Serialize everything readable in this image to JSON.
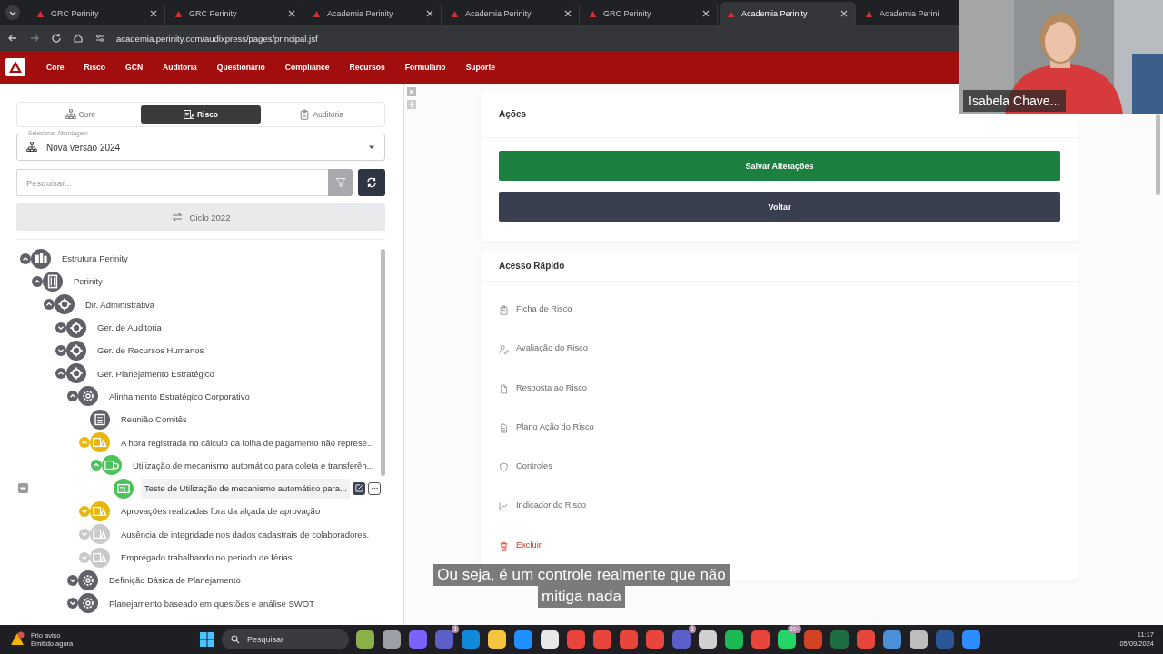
{
  "browser": {
    "tabs": [
      {
        "title": "GRC Perinity",
        "selected": false
      },
      {
        "title": "GRC Perinity",
        "selected": false
      },
      {
        "title": "Academia Perinity",
        "selected": false
      },
      {
        "title": "Academia Perinity",
        "selected": false
      },
      {
        "title": "GRC Perinity",
        "selected": false
      },
      {
        "title": "Academia Perinity",
        "selected": true
      },
      {
        "title": "Academia Perini",
        "selected": false
      }
    ],
    "url": "academia.perinity.com/audixpress/pages/principal.jsf"
  },
  "nav": {
    "items": [
      "Core",
      "Risco",
      "GCN",
      "Auditoria",
      "Questionário",
      "Compliance",
      "Recursos",
      "Formulário",
      "Suporte"
    ]
  },
  "left_panel": {
    "tabs": [
      {
        "label": "Core",
        "kind": "core",
        "selected": false
      },
      {
        "label": "Risco",
        "kind": "risk",
        "selected": true
      },
      {
        "label": "Auditoria",
        "kind": "audit",
        "selected": false
      }
    ],
    "approach": {
      "label": "Selecionar Abordagem",
      "value": "Nova versão 2024"
    },
    "search": {
      "placeholder": "Pesquisar..."
    },
    "cycle_button": "Ciclo 2022",
    "tree": [
      {
        "label": "Estrutura Perinity",
        "kind": "org",
        "color": "#5f6068",
        "expanded": true,
        "selected": false,
        "children": [
          {
            "label": "Perinity",
            "kind": "building",
            "color": "#5f6068",
            "expanded": true,
            "selected": false,
            "children": [
              {
                "label": "Dir. Administrativa",
                "kind": "unit",
                "color": "#5f6068",
                "expanded": true,
                "selected": false,
                "children": [
                  {
                    "label": "Ger. de Auditoria",
                    "kind": "unit",
                    "color": "#5f6068",
                    "expanded": false,
                    "selected": false
                  },
                  {
                    "label": "Ger. de Recursos Humanos",
                    "kind": "unit",
                    "color": "#5f6068",
                    "expanded": false,
                    "selected": false
                  },
                  {
                    "label": "Ger. Planejamento Estratégico",
                    "kind": "unit",
                    "color": "#5f6068",
                    "expanded": true,
                    "selected": false,
                    "children": [
                      {
                        "label": "Alinhamento Estratégico Corporativo",
                        "kind": "process",
                        "color": "#5f6068",
                        "expanded": true,
                        "selected": false,
                        "children": [
                          {
                            "label": "Reunião Comitês",
                            "kind": "list",
                            "color": "#5f6068",
                            "selected": false
                          },
                          {
                            "label": "A hora registrada no cálculo da folha de pagamento não represe...",
                            "kind": "risk",
                            "color": "#e8b70f",
                            "expanded": true,
                            "selected": false,
                            "children": [
                              {
                                "label": "Utilização de mecanismo automático para coleta e transferên...",
                                "kind": "control",
                                "color": "#4cc35a",
                                "expanded": true,
                                "selected": false,
                                "children": [
                                  {
                                    "label": "Teste de Utilização de mecanismo automático para...",
                                    "kind": "test",
                                    "color": "#4cc35a",
                                    "selected": true
                                  }
                                ]
                              }
                            ]
                          },
                          {
                            "label": "Aprovações realizadas fora da alçada de aprovação",
                            "kind": "risk",
                            "color": "#e8b70f",
                            "expanded": false,
                            "selected": false
                          },
                          {
                            "label": "Ausência de integridade nos dados cadastrais de colaboradores.",
                            "kind": "risk",
                            "color": "#c9c9c9",
                            "expanded": false,
                            "selected": false
                          },
                          {
                            "label": "Empregado trabalhando no periodo de férias",
                            "kind": "risk",
                            "color": "#c9c9c9",
                            "expanded": false,
                            "selected": false
                          }
                        ]
                      },
                      {
                        "label": "Definição Básica de Planejamento",
                        "kind": "process",
                        "color": "#5f6068",
                        "expanded": false,
                        "selected": false
                      },
                      {
                        "label": "Planejamento baseado em questões e análise SWOT",
                        "kind": "process",
                        "color": "#5f6068",
                        "expanded": false,
                        "selected": false
                      }
                    ]
                  }
                ]
              }
            ]
          }
        ]
      }
    ]
  },
  "actions": {
    "title": "Ações",
    "buttons": [
      {
        "label": "Salvar Alterações",
        "kind": "save"
      },
      {
        "label": "Voltar",
        "kind": "back"
      }
    ]
  },
  "quick_access": {
    "title": "Acesso Rápido",
    "items": [
      {
        "label": "Ficha de Risco",
        "kind": "sheet"
      },
      {
        "label": "Avaliação do Risco",
        "kind": "assessment"
      },
      {
        "label": "Resposta ao Risco",
        "kind": "response"
      },
      {
        "label": "Plano Ação do Risco",
        "kind": "plan"
      },
      {
        "label": "Controles",
        "kind": "controls"
      },
      {
        "label": "Indicador do Risco",
        "kind": "indicator"
      },
      {
        "label": "Excluir",
        "kind": "delete"
      }
    ]
  },
  "video_tile": {
    "name": "Isabela Chave..."
  },
  "captions": [
    "Ou seja, é um controle realmente que não",
    "mitiga nada"
  ],
  "taskbar": {
    "weather": {
      "title": "Frio aviso",
      "subtitle": "Emitido agora"
    },
    "search_placeholder": "Pesquisar",
    "apps": [
      {
        "color": "#8bb04a"
      },
      {
        "color": "#9aa0a6"
      },
      {
        "color": "#7b61ff"
      },
      {
        "color": "#5b5fc7",
        "badge": "1"
      },
      {
        "color": "#0f8bd9"
      },
      {
        "color": "#f5c542"
      },
      {
        "color": "#1e90ff"
      },
      {
        "color": "#e8e8e8"
      },
      {
        "color": "#e8453c"
      },
      {
        "color": "#e8453c"
      },
      {
        "color": "#e8453c"
      },
      {
        "color": "#e8453c"
      },
      {
        "color": "#5b5fc7",
        "badge": "1"
      },
      {
        "color": "#d0d0d0"
      },
      {
        "color": "#1db954"
      },
      {
        "color": "#e8453c"
      },
      {
        "color": "#25d366",
        "badge": "99+"
      },
      {
        "color": "#d04423"
      },
      {
        "color": "#1d6f42"
      },
      {
        "color": "#e8453c"
      },
      {
        "color": "#4a90d9"
      },
      {
        "color": "#bdbdbd"
      },
      {
        "color": "#2b579a"
      },
      {
        "color": "#2d8cff"
      }
    ],
    "time": "11:17",
    "date": "05/09/2024"
  }
}
